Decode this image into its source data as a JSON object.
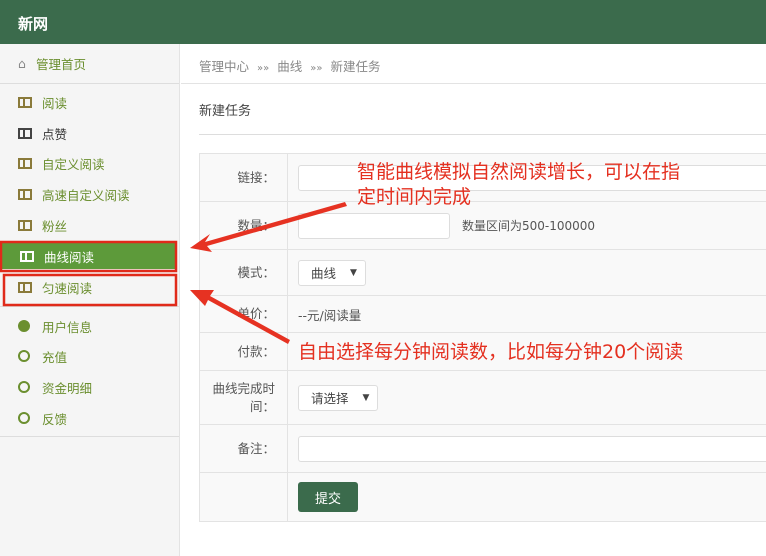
{
  "header": {
    "title": "新网"
  },
  "sidebar": {
    "home": "管理首页",
    "items": [
      {
        "label": "阅读"
      },
      {
        "label": "点赞"
      },
      {
        "label": "自定义阅读"
      },
      {
        "label": "高速自定义阅读"
      },
      {
        "label": "粉丝"
      },
      {
        "label": "曲线阅读"
      },
      {
        "label": "匀速阅读"
      }
    ],
    "account": [
      {
        "label": "用户信息"
      },
      {
        "label": "充值"
      },
      {
        "label": "资金明细"
      },
      {
        "label": "反馈"
      }
    ]
  },
  "breadcrumb": [
    "管理中心",
    "曲线",
    "新建任务"
  ],
  "breadcrumb_sep": "»»",
  "page_title": "新建任务",
  "form": {
    "link_label": "链接：",
    "qty_label": "数量：",
    "qty_hint": "数量区间为500-100000",
    "mode_label": "模式：",
    "mode_value": "曲线",
    "price_label": "单价：",
    "price_value": "--元/阅读量",
    "pay_label": "付款：",
    "time_label": "曲线完成时间：",
    "time_value": "请选择",
    "note_label": "备注：",
    "submit": "提交"
  },
  "annotations": {
    "a1_line1": "智能曲线模拟自然阅读增长，可以在指",
    "a1_line2": "定时间内完成",
    "a2": "自由选择每分钟阅读数，比如每分钟20个阅读"
  },
  "colors": {
    "header": "#3b6b4c",
    "active": "#5d9a3a",
    "annotation": "#e43020"
  }
}
